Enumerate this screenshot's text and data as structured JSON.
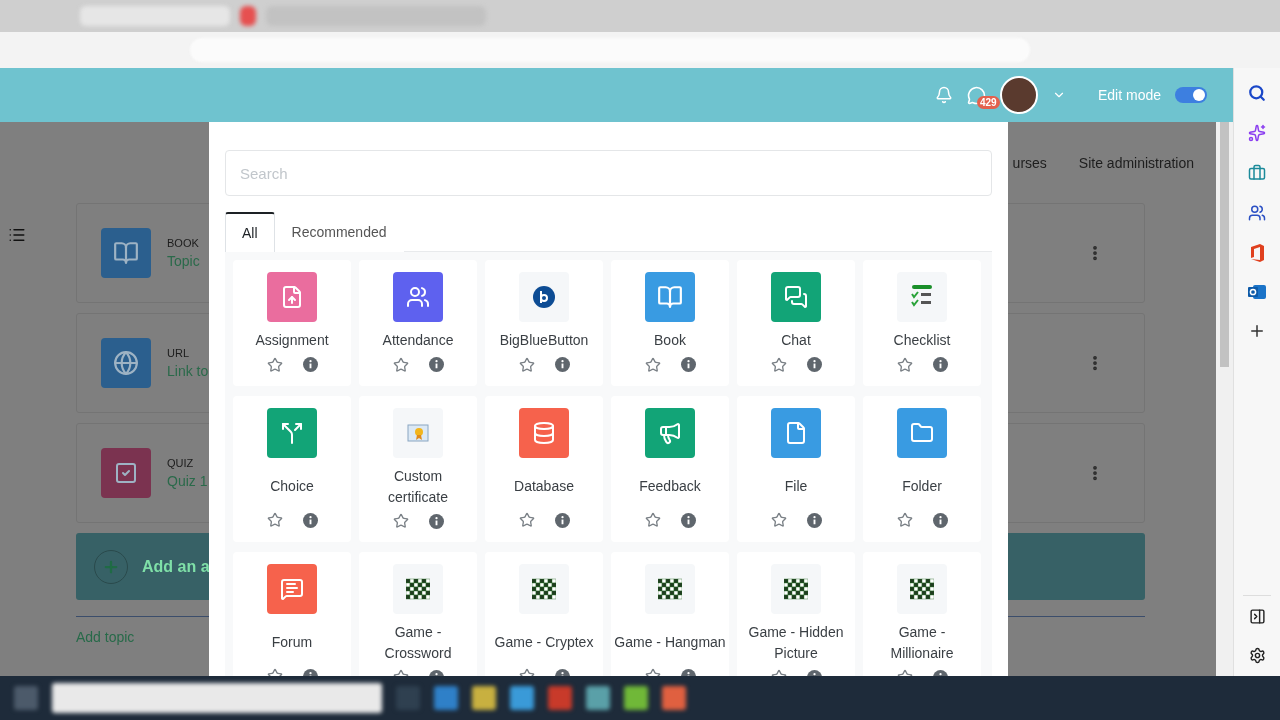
{
  "navbar": {
    "messages_badge": "429",
    "edit_mode": {
      "label": "Edit mode",
      "on": true
    }
  },
  "page": {
    "nav_links": [
      "urses",
      "Site administration"
    ],
    "activities": [
      {
        "type": "BOOK",
        "name": "Topic",
        "kind": "book"
      },
      {
        "type": "URL",
        "name": "Link to",
        "kind": "url"
      },
      {
        "type": "QUIZ",
        "name": "Quiz 1",
        "kind": "quiz"
      }
    ],
    "add_activity": "Add an a",
    "add_topic": "Add topic"
  },
  "chooser": {
    "search": {
      "placeholder": "Search"
    },
    "tabs": [
      {
        "label": "All",
        "selected": true
      },
      {
        "label": "Recommended",
        "selected": false
      }
    ],
    "items": [
      {
        "name": "Assignment",
        "kind": "assignment",
        "starred": false
      },
      {
        "name": "Attendance",
        "kind": "attendance",
        "starred": false
      },
      {
        "name": "BigBlueButton",
        "kind": "bigbluebutton",
        "starred": false
      },
      {
        "name": "Book",
        "kind": "book",
        "starred": false
      },
      {
        "name": "Chat",
        "kind": "chat",
        "starred": false
      },
      {
        "name": "Checklist",
        "kind": "checklist",
        "starred": false
      },
      {
        "name": "Choice",
        "kind": "choice",
        "starred": false
      },
      {
        "name": "Custom certificate",
        "kind": "certificate",
        "starred": false
      },
      {
        "name": "Database",
        "kind": "database",
        "starred": false
      },
      {
        "name": "Feedback",
        "kind": "feedback",
        "starred": false
      },
      {
        "name": "File",
        "kind": "file",
        "starred": false
      },
      {
        "name": "Folder",
        "kind": "folder",
        "starred": false
      },
      {
        "name": "Forum",
        "kind": "forum",
        "starred": false
      },
      {
        "name": "Game - Crossword",
        "kind": "game",
        "starred": false
      },
      {
        "name": "Game - Cryptex",
        "kind": "game",
        "starred": false
      },
      {
        "name": "Game - Hangman",
        "kind": "game",
        "starred": false
      },
      {
        "name": "Game - Hidden Picture",
        "kind": "game",
        "starred": false
      },
      {
        "name": "Game - Millionaire",
        "kind": "game",
        "starred": false
      }
    ]
  }
}
